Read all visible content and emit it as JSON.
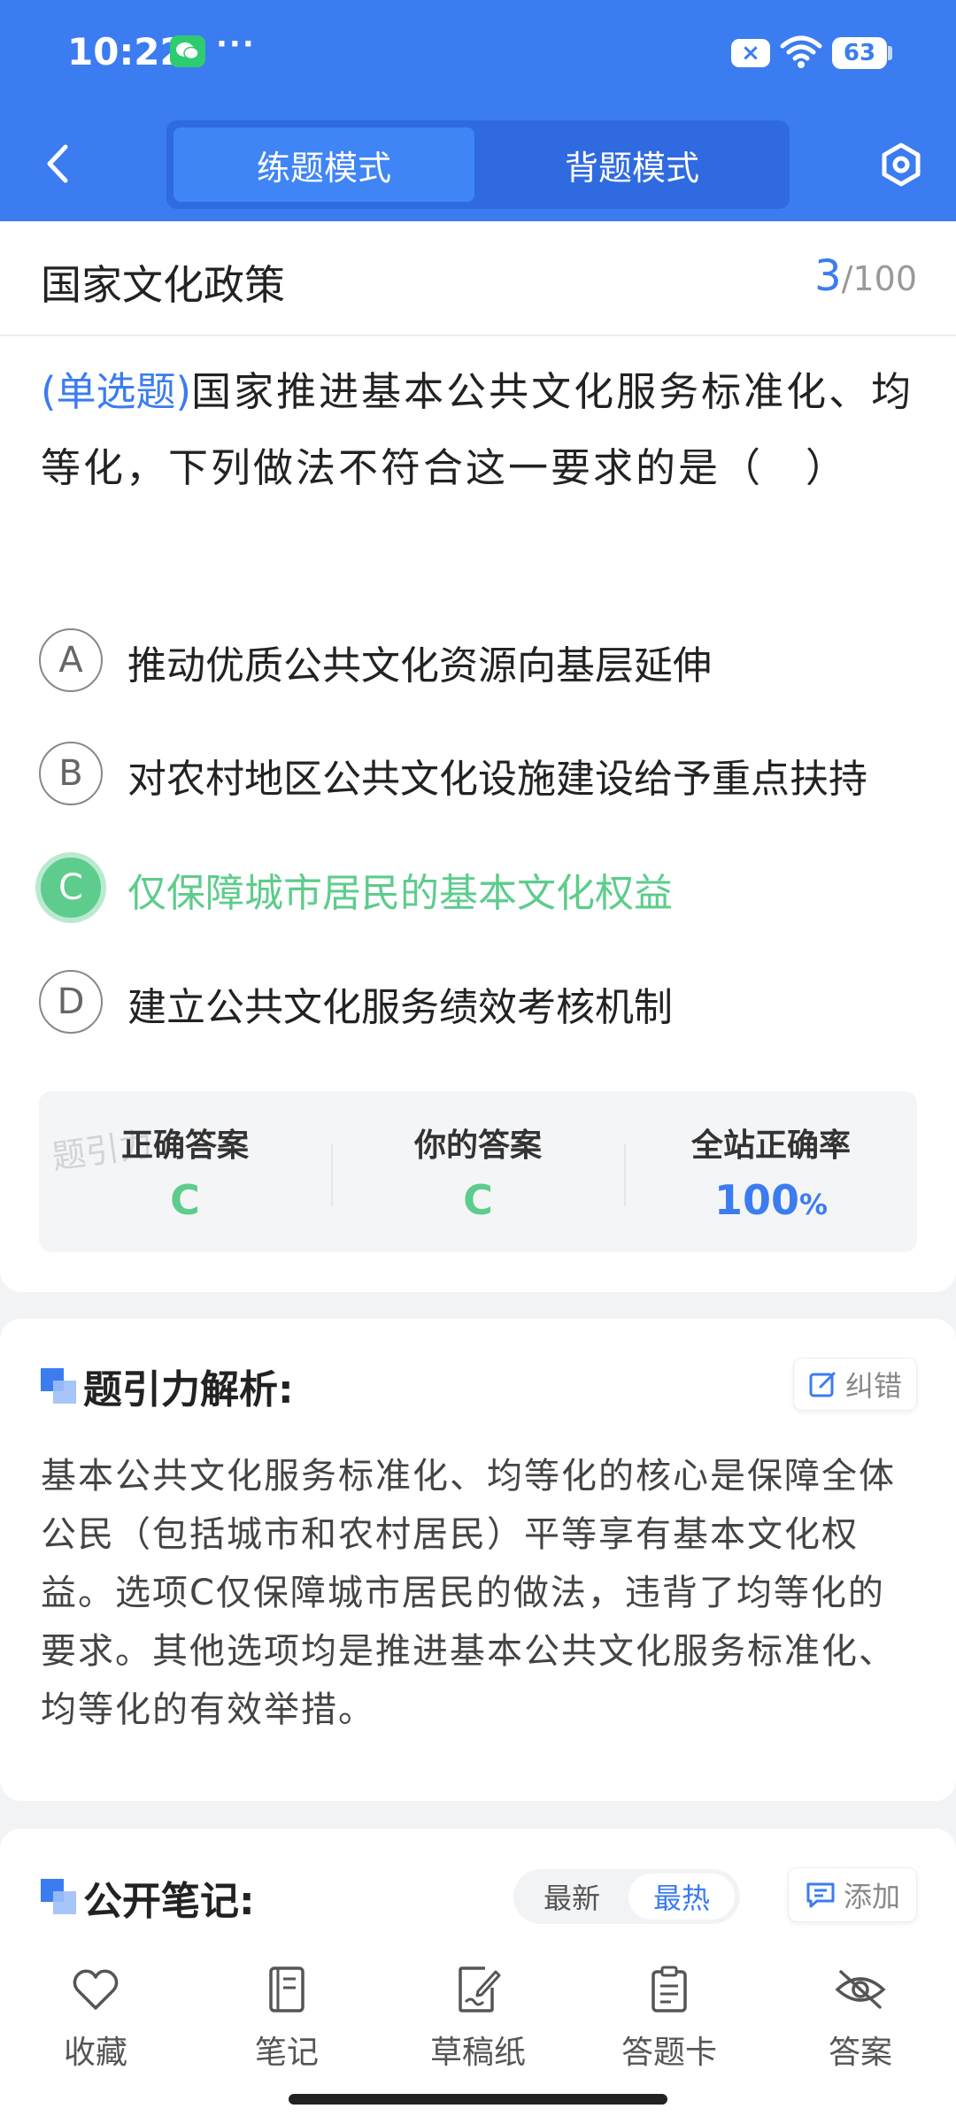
{
  "status_bar": {
    "time": "10:22",
    "dots": "···",
    "x_badge": "×",
    "battery": "63"
  },
  "header": {
    "mode_tabs": [
      {
        "label": "练题模式",
        "active": true
      },
      {
        "label": "背题模式",
        "active": false
      }
    ]
  },
  "subject": {
    "title": "国家文化政策",
    "current": "3",
    "total": "/100"
  },
  "question": {
    "type": "(单选题)",
    "text": "国家推进基本公共文化服务标准化、均等化，下列做法不符合这一要求的是（　）"
  },
  "options": [
    {
      "letter": "A",
      "text": "推动优质公共文化资源向基层延伸",
      "state": "normal"
    },
    {
      "letter": "B",
      "text": "对农村地区公共文化设施建设给予重点扶持",
      "state": "normal"
    },
    {
      "letter": "C",
      "text": "仅保障城市居民的基本文化权益",
      "state": "correct"
    },
    {
      "letter": "D",
      "text": "建立公共文化服务绩效考核机制",
      "state": "normal"
    }
  ],
  "result": {
    "watermark": "题引力",
    "correct_label": "正确答案",
    "correct_value": "C",
    "yours_label": "你的答案",
    "yours_value": "C",
    "rate_label": "全站正确率",
    "rate_value": "100",
    "rate_unit": "%"
  },
  "analysis": {
    "title": "题引力解析:",
    "report_label": "纠错",
    "text": "基本公共文化服务标准化、均等化的核心是保障全体公民（包括城市和农村居民）平等享有基本文化权益。选项C仅保障城市居民的做法，违背了均等化的要求。其他选项均是推进基本公共文化服务标准化、均等化的有效举措。"
  },
  "notes": {
    "title": "公开笔记:",
    "sort_newest": "最新",
    "sort_hottest": "最热",
    "add_label": "添加"
  },
  "bottom_nav": [
    {
      "label": "收藏",
      "icon": "heart-icon"
    },
    {
      "label": "笔记",
      "icon": "notebook-icon"
    },
    {
      "label": "草稿纸",
      "icon": "draft-icon"
    },
    {
      "label": "答题卡",
      "icon": "answer-sheet-icon"
    },
    {
      "label": "答案",
      "icon": "eye-off-icon"
    }
  ],
  "colors": {
    "primary": "#3b7cf0",
    "correct": "#5dcc8c",
    "background": "#f2f3f5"
  }
}
